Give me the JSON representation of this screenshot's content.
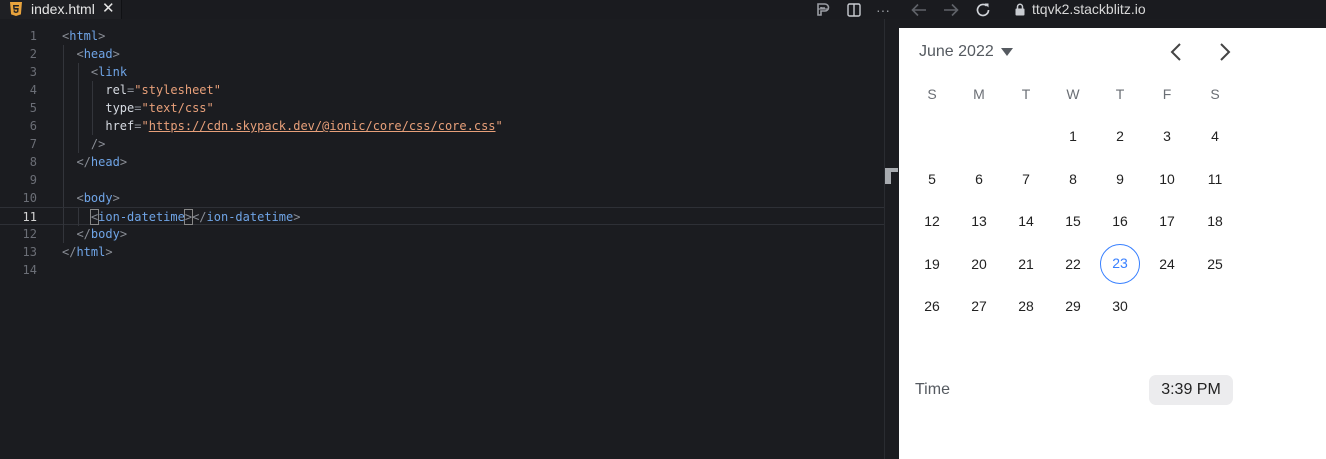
{
  "tab": {
    "filename": "index.html",
    "close_icon": "close-icon",
    "file_icon": "html5-icon"
  },
  "toolbar": {
    "icons": [
      "prettier-icon",
      "split-view-icon",
      "more-icon",
      "back-arrow-icon",
      "forward-arrow-icon",
      "refresh-icon"
    ],
    "more_glyph": "···"
  },
  "address": {
    "url": "ttqvk2.stackblitz.io",
    "icon": "lock-icon"
  },
  "editor": {
    "active_line": 11,
    "line_numbers": [
      "1",
      "2",
      "3",
      "4",
      "5",
      "6",
      "7",
      "8",
      "9",
      "10",
      "11",
      "12",
      "13",
      "14"
    ],
    "colors": {
      "tag": "#6fa4e6",
      "string": "#e8a07a",
      "attribute": "#d7dbe2"
    }
  },
  "calendar": {
    "month_label": "June 2022",
    "weekdays": [
      "S",
      "M",
      "T",
      "W",
      "T",
      "F",
      "S"
    ],
    "first_weekday_index": 3,
    "days": [
      "1",
      "2",
      "3",
      "4",
      "5",
      "6",
      "7",
      "8",
      "9",
      "10",
      "11",
      "12",
      "13",
      "14",
      "15",
      "16",
      "17",
      "18",
      "19",
      "20",
      "21",
      "22",
      "23",
      "24",
      "25",
      "26",
      "27",
      "28",
      "29",
      "30"
    ],
    "selected_day": "23",
    "accent_color": "#3880ff"
  },
  "time": {
    "label": "Time",
    "value": "3:39 PM"
  }
}
